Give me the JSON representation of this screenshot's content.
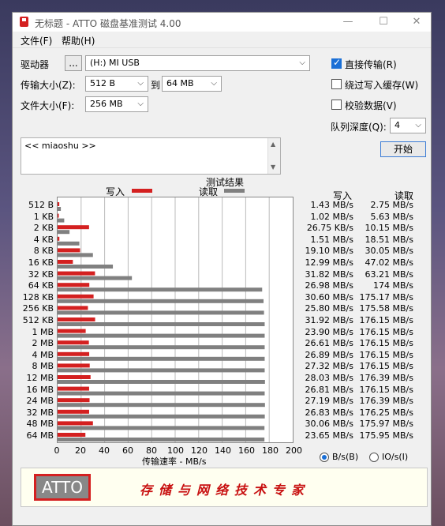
{
  "window": {
    "title": "无标题 - ATTO 磁盘基准测试 4.00",
    "min": "—",
    "max": "☐",
    "close": "✕"
  },
  "menu": {
    "file": "文件(F)",
    "help": "帮助(H)"
  },
  "controls": {
    "drive_label": "驱动器",
    "browse_label": "...",
    "drive_value": "(H:) MI USB",
    "transfer_label": "传输大小(Z):",
    "transfer_from": "512 B",
    "to_label": "到",
    "transfer_to": "64 MB",
    "file_label": "文件大小(F):",
    "file_value": "256 MB",
    "direct_io": "直接传输(R)",
    "bypass_cache": "绕过写入缓存(W)",
    "verify": "校验数据(V)",
    "queue_label": "队列深度(Q):",
    "queue_value": "4",
    "start": "开始",
    "description": "<< miaoshu >>"
  },
  "checks": {
    "direct_io": true,
    "bypass_cache": false,
    "verify": false
  },
  "results": {
    "title": "测试结果",
    "legend_write": "写入",
    "legend_read": "读取",
    "col_write": "写入",
    "col_read": "读取",
    "x_axis_label": "传输速率 - MB/s",
    "unit_bytes": "B/s(B)",
    "unit_io": "IO/s(I)"
  },
  "colors": {
    "write": "#d42020",
    "read": "#808080"
  },
  "chart_data": {
    "type": "bar",
    "orientation": "horizontal",
    "categories": [
      "512 B",
      "1 KB",
      "2 KB",
      "4 KB",
      "8 KB",
      "16 KB",
      "32 KB",
      "64 KB",
      "128 KB",
      "256 KB",
      "512 KB",
      "1 MB",
      "2 MB",
      "4 MB",
      "8 MB",
      "12 MB",
      "16 MB",
      "24 MB",
      "32 MB",
      "48 MB",
      "64 MB"
    ],
    "series": [
      {
        "name": "写入",
        "values": [
          1.43,
          1.02,
          26.75,
          1.51,
          19.1,
          12.99,
          31.82,
          26.98,
          30.6,
          25.8,
          31.92,
          23.9,
          26.61,
          26.89,
          27.32,
          28.03,
          26.81,
          27.19,
          26.83,
          30.06,
          23.65
        ]
      },
      {
        "name": "读取",
        "values": [
          2.75,
          5.63,
          10.15,
          18.51,
          30.05,
          47.02,
          63.21,
          174,
          175.17,
          175.58,
          176.15,
          176.15,
          176.15,
          176.15,
          176.15,
          176.39,
          176.15,
          176.39,
          176.25,
          175.97,
          175.95
        ]
      }
    ],
    "write_text": [
      "1.43 MB/s",
      "1.02 MB/s",
      "26.75 KB/s",
      "1.51 MB/s",
      "19.10 MB/s",
      "12.99 MB/s",
      "31.82 MB/s",
      "26.98 MB/s",
      "30.60 MB/s",
      "25.80 MB/s",
      "31.92 MB/s",
      "23.90 MB/s",
      "26.61 MB/s",
      "26.89 MB/s",
      "27.32 MB/s",
      "28.03 MB/s",
      "26.81 MB/s",
      "27.19 MB/s",
      "26.83 MB/s",
      "30.06 MB/s",
      "23.65 MB/s"
    ],
    "read_text": [
      "2.75 MB/s",
      "5.63 MB/s",
      "10.15 MB/s",
      "18.51 MB/s",
      "30.05 MB/s",
      "47.02 MB/s",
      "63.21 MB/s",
      "174 MB/s",
      "175.17 MB/s",
      "175.58 MB/s",
      "176.15 MB/s",
      "176.15 MB/s",
      "176.15 MB/s",
      "176.15 MB/s",
      "176.15 MB/s",
      "176.39 MB/s",
      "176.15 MB/s",
      "176.39 MB/s",
      "176.25 MB/s",
      "175.97 MB/s",
      "175.95 MB/s"
    ],
    "x_ticks": [
      "0",
      "20",
      "40",
      "60",
      "80",
      "100",
      "120",
      "140",
      "160",
      "180",
      "200"
    ],
    "xlim": [
      0,
      200
    ],
    "xlabel": "传输速率 - MB/s"
  },
  "banner": {
    "logo": "ATTO",
    "slogan": "存储与网络技术专家"
  }
}
